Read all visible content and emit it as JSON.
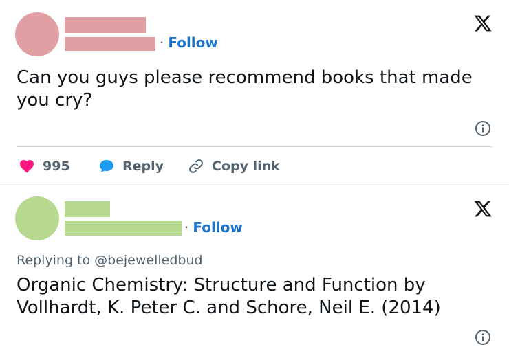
{
  "tweet1": {
    "follow_label": "Follow",
    "text": "Can you guys please recommend books that made you cry?",
    "likes": "995",
    "reply_label": "Reply",
    "copy_link_label": "Copy link",
    "colors": {
      "avatar": "#e0a0a3",
      "name_bar": "#e0a0a3"
    }
  },
  "tweet2": {
    "follow_label": "Follow",
    "replying_to": "Replying to @bejewelledbud",
    "text": "Organic Chemistry: Structure and Function by Vollhardt, K. Peter C. and Schore, Neil E. (2014)",
    "colors": {
      "avatar": "#b6d98f",
      "name_bar": "#b6d98f"
    }
  },
  "icons": {
    "x_logo": "x-logo-icon",
    "info": "info-icon",
    "heart": "heart-icon",
    "reply": "reply-bubble-icon",
    "link": "link-icon"
  },
  "colors": {
    "accent": "#1d74c8",
    "like": "#f91880",
    "reply_bubble": "#1d9bf0",
    "muted": "#536471"
  }
}
